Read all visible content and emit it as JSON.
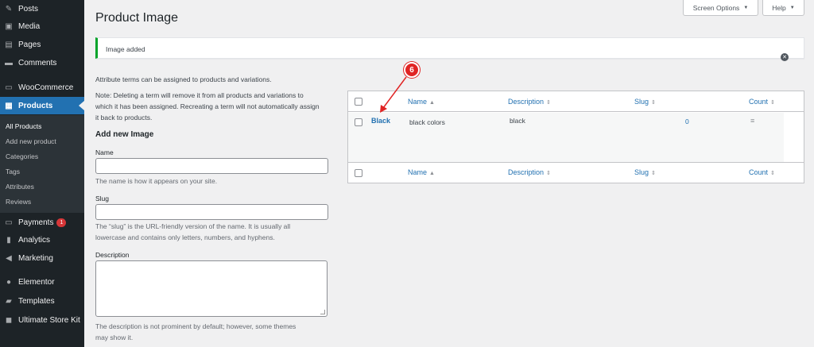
{
  "sidebar": {
    "items": [
      {
        "label": "Posts",
        "icon": "pin-icon"
      },
      {
        "label": "Media",
        "icon": "media-icon"
      },
      {
        "label": "Pages",
        "icon": "pages-icon"
      },
      {
        "label": "Comments",
        "icon": "comments-icon"
      },
      {
        "label": "WooCommerce",
        "icon": "woocommerce-icon"
      },
      {
        "label": "Products",
        "icon": "products-icon"
      },
      {
        "label": "Payments",
        "icon": "payments-icon",
        "badge": "1"
      },
      {
        "label": "Analytics",
        "icon": "analytics-icon"
      },
      {
        "label": "Marketing",
        "icon": "marketing-icon"
      },
      {
        "label": "Elementor",
        "icon": "elementor-icon"
      },
      {
        "label": "Templates",
        "icon": "templates-icon"
      },
      {
        "label": "Ultimate Store Kit",
        "icon": "store-kit-icon"
      }
    ],
    "submenu": [
      "All Products",
      "Add new product",
      "Categories",
      "Tags",
      "Attributes",
      "Reviews"
    ]
  },
  "header": {
    "title": "Product Image",
    "screen_options": "Screen Options",
    "help": "Help"
  },
  "notice": {
    "text": "Image added"
  },
  "form": {
    "intro": "Attribute terms can be assigned to products and variations.",
    "note_l1": "Note: Deleting a term will remove it from all products and variations to",
    "note_l2": "which it has been assigned. Recreating a term will not automatically assign",
    "note_l3": "it back to products.",
    "heading": "Add new Image",
    "name_label": "Name",
    "name_help": "The name is how it appears on your site.",
    "slug_label": "Slug",
    "slug_help_l1": "The “slug” is the URL-friendly version of the name. It is usually all",
    "slug_help_l2": "lowercase and contains only letters, numbers, and hyphens.",
    "desc_label": "Description",
    "desc_help_l1": "The description is not prominent by default; however, some themes",
    "desc_help_l2": "may show it."
  },
  "table": {
    "columns": [
      "Name",
      "Description",
      "Slug",
      "Count"
    ],
    "rows": [
      {
        "name": "Black",
        "description": "black colors",
        "slug": "black",
        "count": "0"
      }
    ]
  },
  "annotation": {
    "step": "6"
  },
  "colors": {
    "sidebar": "#1d2327",
    "accent": "#2271b1",
    "notice": "#00a32a",
    "marker": "#e02424"
  }
}
